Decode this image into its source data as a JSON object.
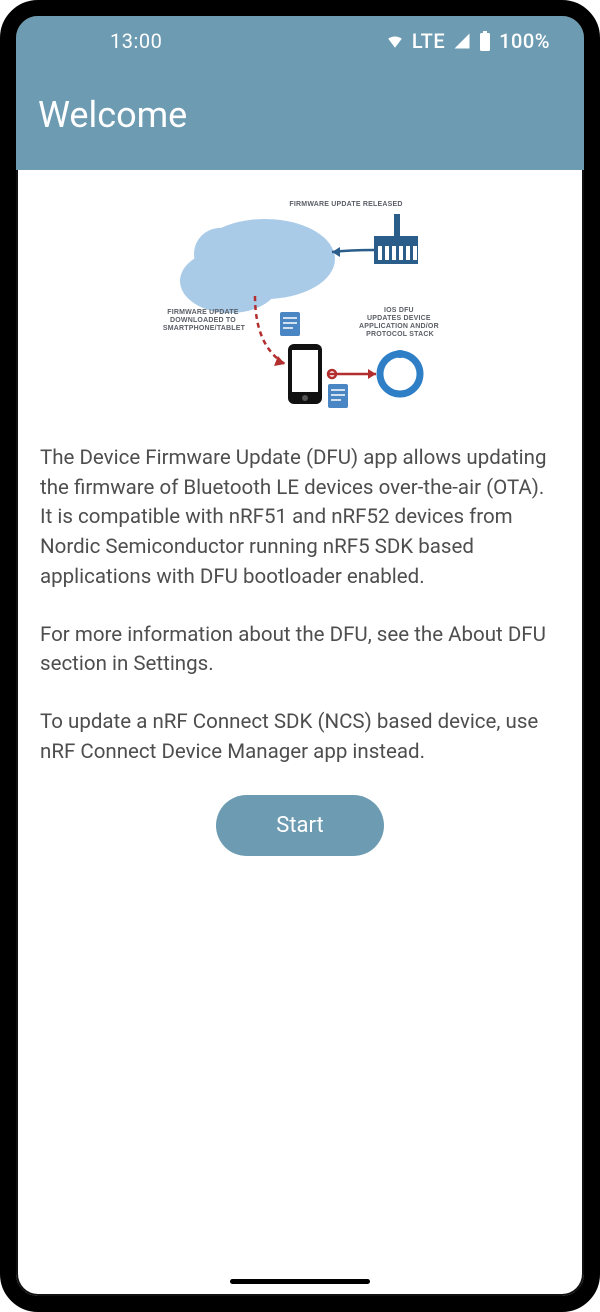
{
  "status": {
    "time": "13:00",
    "network_label": "LTE",
    "battery_label": "100%"
  },
  "appbar": {
    "title": "Welcome"
  },
  "illustration": {
    "label_top": "FIRMWARE UPDATE RELEASED",
    "label_left": "FIRMWARE UPDATE DOWNLOADED TO SMARTPHONE/TABLET",
    "label_right_1": "IOS DFU",
    "label_right_2": "UPDATES DEVICE APPLICATION AND/OR PROTOCOL STACK"
  },
  "body": {
    "p1": "The Device Firmware Update (DFU) app allows updating the firmware of Bluetooth LE devices over-the-air (OTA). It is compatible with nRF51 and nRF52 devices from Nordic Semiconductor running nRF5 SDK based applications with DFU bootloader enabled.",
    "p2": "For more information about the DFU, see the About DFU section in Settings.",
    "p3": "To update a nRF Connect SDK (NCS) based device, use nRF Connect Device Manager app instead."
  },
  "actions": {
    "start": "Start"
  }
}
